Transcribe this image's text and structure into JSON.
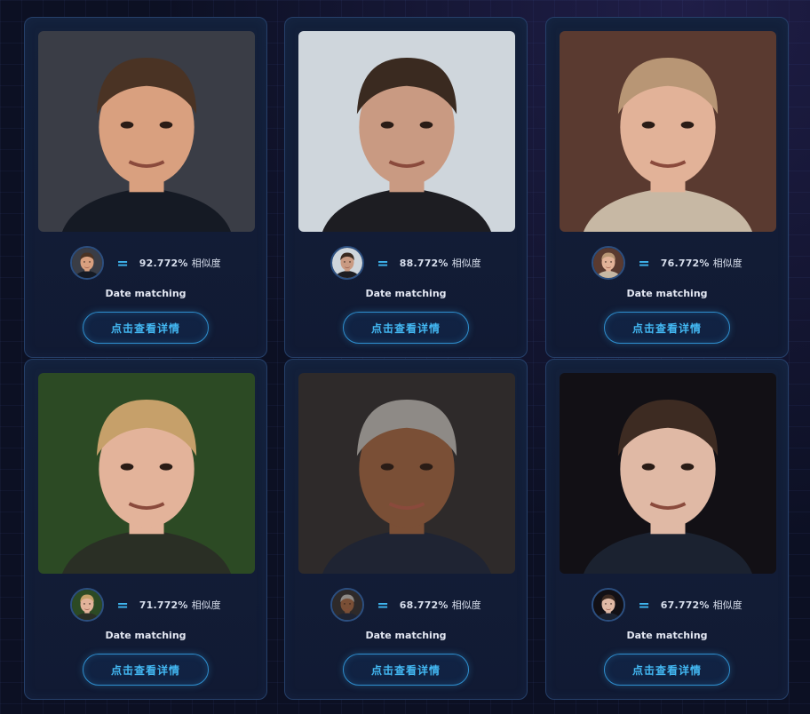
{
  "results": [
    {
      "similarity": "92.772%",
      "similarity_label": "相似度",
      "match_label": "Date matching",
      "detail_button": "点击查看详情",
      "skin": "#d9a07f",
      "hair": "#4a3324",
      "bg": "#3a3d46",
      "shirt": "#151a24"
    },
    {
      "similarity": "88.772%",
      "similarity_label": "相似度",
      "match_label": "Date matching",
      "detail_button": "点击查看详情",
      "skin": "#c99a82",
      "hair": "#3a2a20",
      "bg": "#cfd6dc",
      "shirt": "#1d1d22"
    },
    {
      "similarity": "76.772%",
      "similarity_label": "相似度",
      "match_label": "Date matching",
      "detail_button": "点击查看详情",
      "skin": "#e2b298",
      "hair": "#b89675",
      "bg": "#5a3a30",
      "shirt": "#c7b8a4"
    },
    {
      "similarity": "71.772%",
      "similarity_label": "相似度",
      "match_label": "Date matching",
      "detail_button": "点击查看详情",
      "skin": "#e3b39a",
      "hair": "#c6a06a",
      "bg": "#2c4a24",
      "shirt": "#2a2f25"
    },
    {
      "similarity": "68.772%",
      "similarity_label": "相似度",
      "match_label": "Date matching",
      "detail_button": "点击查看详情",
      "skin": "#7a4f36",
      "hair": "#8e8a86",
      "bg": "#2e2a2a",
      "shirt": "#1f2433"
    },
    {
      "similarity": "67.772%",
      "similarity_label": "相似度",
      "match_label": "Date matching",
      "detail_button": "点击查看详情",
      "skin": "#e0b9a5",
      "hair": "#3d2b22",
      "bg": "#121015",
      "shirt": "#1b2230"
    }
  ]
}
